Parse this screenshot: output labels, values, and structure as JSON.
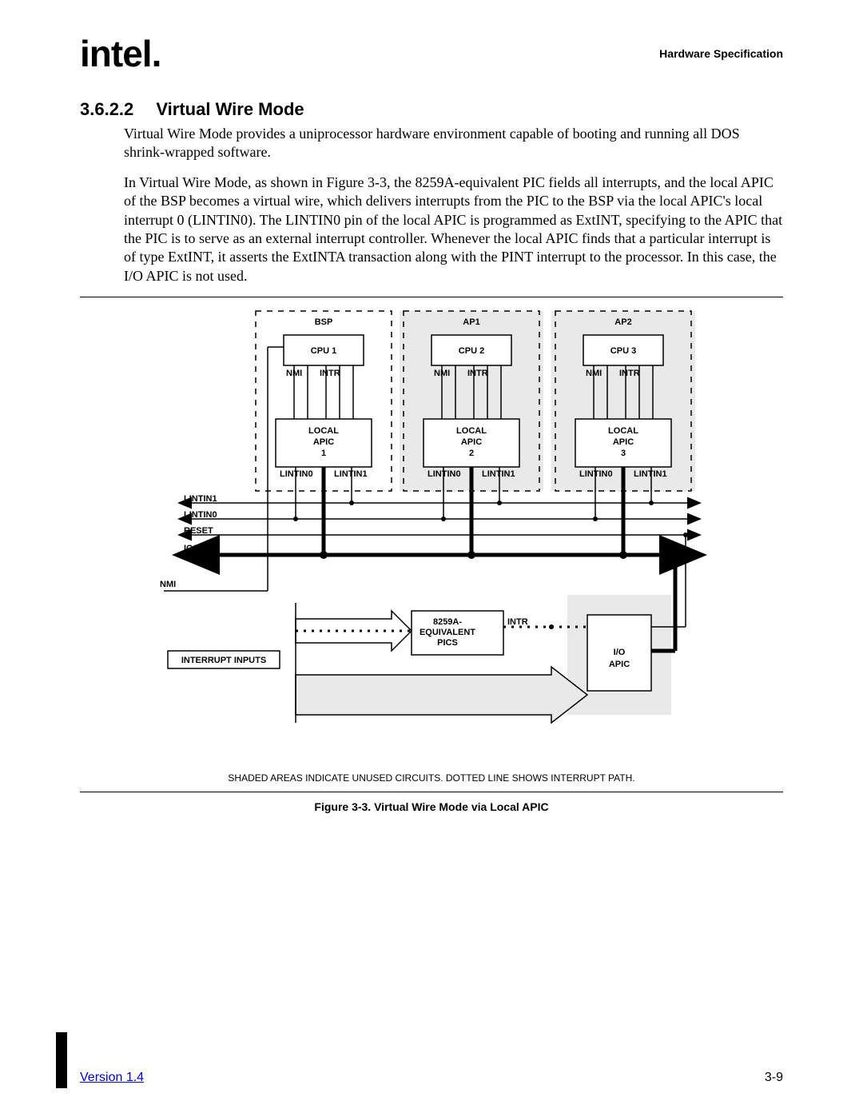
{
  "header": {
    "logo_text": "intel",
    "spec_title": "Hardware Specification"
  },
  "section": {
    "number": "3.6.2.2",
    "title": "Virtual Wire Mode",
    "paragraphs": [
      "Virtual Wire Mode provides a uniprocessor hardware environment capable of booting and running all DOS shrink-wrapped software.",
      "In Virtual Wire Mode, as shown in Figure 3-3, the 8259A-equivalent PIC fields all interrupts, and the local APIC of the BSP becomes a virtual wire, which delivers interrupts from the PIC to the BSP via the local APIC's local interrupt 0 (LINTIN0).  The LINTIN0 pin of the local APIC is programmed as ExtINT, specifying to the APIC that the PIC is to serve as an external interrupt controller.  Whenever the local APIC finds that a particular interrupt is of type ExtINT, it asserts the ExtINTA transaction along with the PINT interrupt to the processor.  In this case, the I/O APIC is not used."
    ]
  },
  "figure": {
    "caption": "Figure 3-3.  Virtual Wire Mode via Local APIC",
    "note": "SHADED AREAS INDICATE UNUSED CIRCUITS.  DOTTED LINE SHOWS INTERRUPT PATH.",
    "cpus": [
      {
        "role": "BSP",
        "cpu": "CPU 1",
        "apic": "LOCAL\nAPIC\n1",
        "shaded": false
      },
      {
        "role": "AP1",
        "cpu": "CPU 2",
        "apic": "LOCAL\nAPIC\n2",
        "shaded": true
      },
      {
        "role": "AP2",
        "cpu": "CPU 3",
        "apic": "LOCAL\nAPIC\n3",
        "shaded": true
      }
    ],
    "pin_labels": {
      "nmi": "NMI",
      "intr": "INTR",
      "lin0": "LINTIN0",
      "lin1": "LINTIN1"
    },
    "hbus_labels": [
      "LINTIN1",
      "LINTIN0",
      "RESET",
      "ICC BUS"
    ],
    "nmi_label": "NMI",
    "int_inputs": "INTERRUPT INPUTS",
    "pic_label": "8259A-\nEQUIVALENT\nPICS",
    "pic_intr": "INTR",
    "ioapic": "I/O\nAPIC",
    "ioapic_shaded": true
  },
  "footer": {
    "version": "Version 1.4",
    "page_number": "3-9"
  }
}
